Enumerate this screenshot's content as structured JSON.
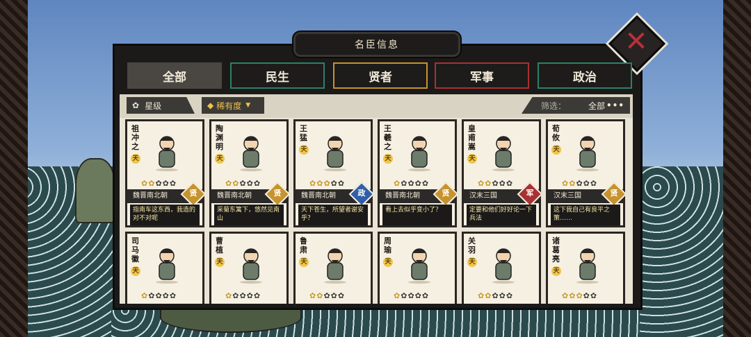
{
  "panel_title": "名臣信息",
  "tabs": [
    {
      "label": "全部",
      "color": "#4a4743"
    },
    {
      "label": "民生",
      "color": "#2f7f6a"
    },
    {
      "label": "贤者",
      "color": "#c7932e"
    },
    {
      "label": "军事",
      "color": "#a83232"
    },
    {
      "label": "政治",
      "color": "#2f7f6a"
    }
  ],
  "filters": {
    "star_label": "星级",
    "rarity_label": "稀有度",
    "screen_label": "筛选：",
    "screen_value": "全部",
    "more": "•••"
  },
  "tier_label": "天",
  "cards": [
    {
      "name": "祖冲之",
      "dynasty": "魏晋南北朝",
      "type": "贤",
      "type_color": "#c7932e",
      "stars": 2,
      "quote": "指南车这东西，我造的对不对呢"
    },
    {
      "name": "陶渊明",
      "dynasty": "魏晋南北朝",
      "type": "贤",
      "type_color": "#c7932e",
      "stars": 2,
      "quote": "采菊东篱下，悠然见南山"
    },
    {
      "name": "王猛",
      "dynasty": "魏晋南北朝",
      "type": "政",
      "type_color": "#2f5fa8",
      "stars": 3,
      "quote": "天下苍生，所望者谢安乎？"
    },
    {
      "name": "王羲之",
      "dynasty": "魏晋南北朝",
      "type": "贤",
      "type_color": "#c7932e",
      "stars": 1,
      "quote": "看上去似乎变小了？"
    },
    {
      "name": "皇甫嵩",
      "dynasty": "汉末三国",
      "type": "军",
      "type_color": "#a83232",
      "stars": 2,
      "quote": "定要和他们好好论一下兵法"
    },
    {
      "name": "荀攸",
      "dynasty": "汉末三国",
      "type": "贤",
      "type_color": "#c7932e",
      "stars": 2,
      "quote": "这下我自己有良平之策……"
    },
    {
      "name": "司马徽",
      "stars": 1
    },
    {
      "name": "曹植",
      "stars": 1
    },
    {
      "name": "鲁肃",
      "stars": 2
    },
    {
      "name": "周瑜",
      "stars": 1
    },
    {
      "name": "关羽",
      "stars": 2
    },
    {
      "name": "诸葛亮",
      "stars": 3
    }
  ]
}
